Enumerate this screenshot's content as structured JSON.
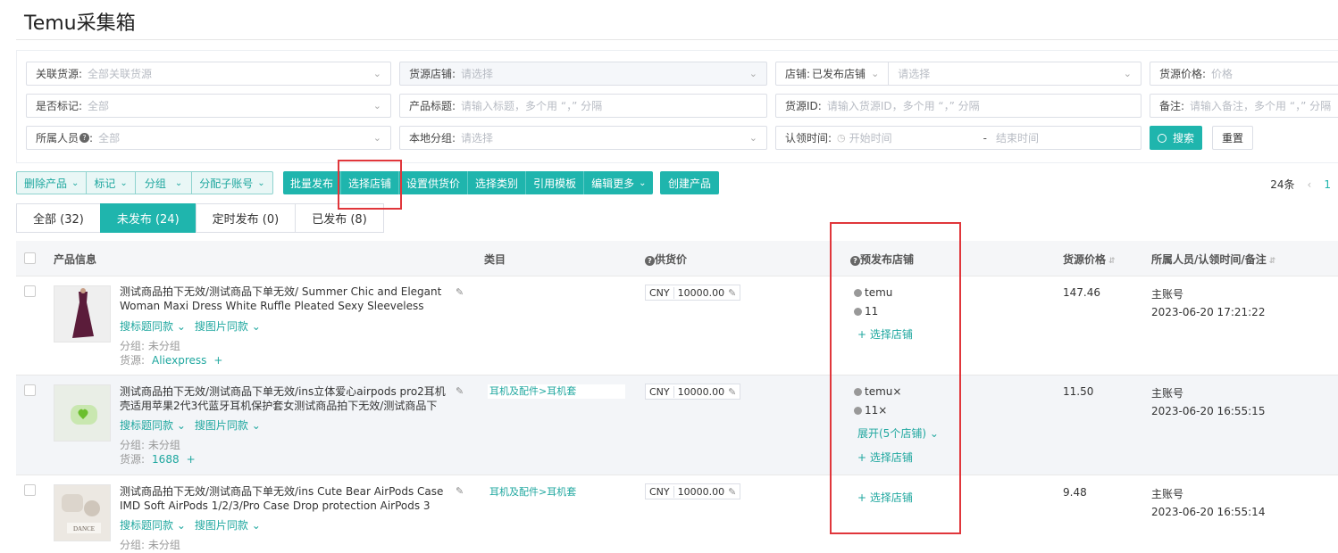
{
  "page": {
    "title": "Temu采集箱"
  },
  "filters": {
    "linked_source": {
      "label": "关联货源:",
      "placeholder": "全部关联货源"
    },
    "source_store": {
      "label": "货源店铺:",
      "placeholder": "请选择"
    },
    "store_status": {
      "label": "店铺:",
      "value": "已发布店铺",
      "placeholder": "请选择"
    },
    "source_price": {
      "label": "货源价格:",
      "placeholder": "价格"
    },
    "is_marked": {
      "label": "是否标记:",
      "value": "全部"
    },
    "product_title": {
      "label": "产品标题:",
      "placeholder": "请输入标题，多个用 “，” 分隔"
    },
    "source_id": {
      "label": "货源ID:",
      "placeholder": "请输入货源ID，多个用 “，” 分隔"
    },
    "remark": {
      "label": "备注:",
      "placeholder": "请输入备注，多个用 “，” 分隔"
    },
    "owner": {
      "label": "所属人员",
      "value": "全部"
    },
    "local_group": {
      "label": "本地分组:",
      "placeholder": "请选择"
    },
    "claim_time": {
      "label": "认领时间:",
      "start_placeholder": "开始时间",
      "separator": "-",
      "end_placeholder": "结束时间"
    },
    "search_label": "搜索",
    "reset_label": "重置"
  },
  "toolbar": {
    "outline_buttons": [
      "删除产品",
      "标记",
      "分组",
      "分配子账号"
    ],
    "solid_buttons": [
      "批量发布",
      "选择店铺",
      "设置供货价",
      "选择类别",
      "引用模板",
      "编辑更多"
    ],
    "create_label": "创建产品"
  },
  "pager": {
    "total": "24条",
    "page": "1"
  },
  "tabs": [
    {
      "label": "全部 (32)",
      "active": false
    },
    {
      "label": "未发布 (24)",
      "active": true
    },
    {
      "label": "定时发布 (0)",
      "active": false
    },
    {
      "label": "已发布 (8)",
      "active": false
    }
  ],
  "table": {
    "headers": {
      "product": "产品信息",
      "category": "类目",
      "supply_price": "供货价",
      "pre_store": "预发布店铺",
      "source_price": "货源价格",
      "owner": "所属人员/认领时间/备注"
    },
    "link_title": "搜标题同款",
    "link_image": "搜图片同款",
    "group_text": "分组: 未分组",
    "source_text": "货源:",
    "add_store": "+ 选择店铺",
    "rows": [
      {
        "title": "测试商品拍下无效/测试商品下单无效/ Summer Chic and Elegant Woman Maxi Dress White Ruffle Pleated Sexy Sleeveless Party...",
        "category": "",
        "currency": "CNY",
        "price": "10000.00",
        "stores": [
          "temu",
          "11"
        ],
        "expand": "",
        "source_price": "147.46",
        "owner": "主账号",
        "time": "2023-06-20 17:21:22",
        "source": "Aliexpress",
        "thumb_color": "#5b1c3a"
      },
      {
        "title": "测试商品拍下无效/测试商品下单无效/ins立体爱心airpods pro2耳机壳适用苹果2代3代蓝牙耳机保护套女测试商品拍下无效/测试商品下无...",
        "category": "耳机及配件>耳机套",
        "currency": "CNY",
        "price": "10000.00",
        "stores": [
          "temu×",
          "11×"
        ],
        "expand": "展开(5个店铺)",
        "source_price": "11.50",
        "owner": "主账号",
        "time": "2023-06-20 16:55:15",
        "source": "1688",
        "thumb_color": "#c9e7b0"
      },
      {
        "title": "测试商品拍下无效/测试商品下单无效/ins Cute Bear AirPods Case IMD Soft AirPods 1/2/3/Pro Case Drop protection AirPods 3 Pro...",
        "category": "耳机及配件>耳机套",
        "currency": "CNY",
        "price": "10000.00",
        "stores": [],
        "expand": "",
        "source_price": "9.48",
        "owner": "主账号",
        "time": "2023-06-20 16:55:14",
        "source": "",
        "thumb_color": "#e8e4de"
      }
    ]
  },
  "colors": {
    "accent": "#1fb5ad",
    "highlight": "#e0363b"
  }
}
